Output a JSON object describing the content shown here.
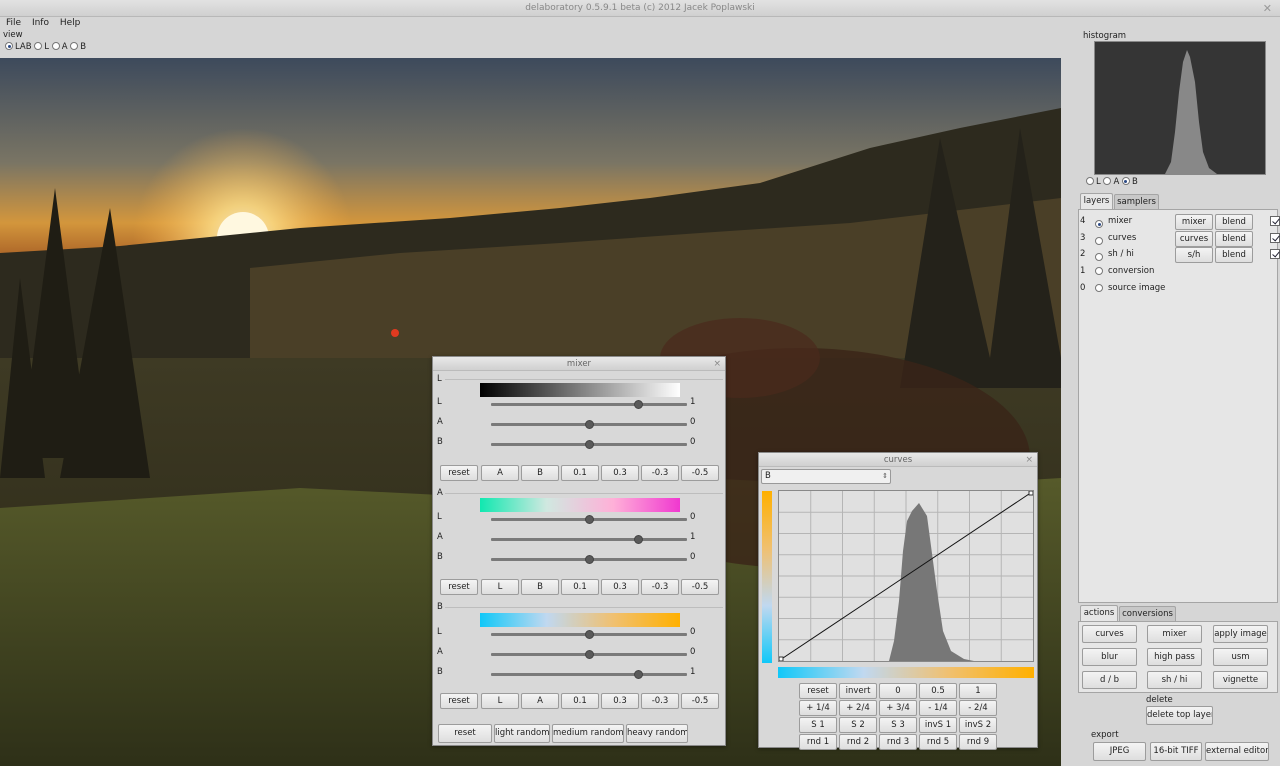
{
  "window": {
    "title": "delaboratory 0.5.9.1 beta (c) 2012 Jacek Poplawski"
  },
  "menu": [
    "File",
    "Info",
    "Help"
  ],
  "view": {
    "label": "view",
    "options": [
      "LAB",
      "L",
      "A",
      "B"
    ],
    "selected": "LAB"
  },
  "histogram": {
    "label": "histogram",
    "options": [
      "L",
      "A",
      "B"
    ],
    "selected": "B"
  },
  "layers_tabs": [
    "layers",
    "samplers"
  ],
  "layers": [
    {
      "index": "4",
      "name": "mixer",
      "selected": true,
      "buttons": [
        "mixer",
        "blend"
      ],
      "enabled": true
    },
    {
      "index": "3",
      "name": "curves",
      "selected": false,
      "buttons": [
        "curves",
        "blend"
      ],
      "enabled": true
    },
    {
      "index": "2",
      "name": "sh / hi",
      "selected": false,
      "buttons": [
        "s/h",
        "blend"
      ],
      "enabled": true
    },
    {
      "index": "1",
      "name": "conversion",
      "selected": false,
      "buttons": [],
      "enabled": false
    },
    {
      "index": "0",
      "name": "source image",
      "selected": false,
      "buttons": [],
      "enabled": false
    }
  ],
  "actions_tabs": [
    "actions",
    "conversions"
  ],
  "actions": [
    "curves",
    "mixer",
    "apply image",
    "blur",
    "high pass",
    "usm",
    "d / b",
    "sh / hi",
    "vignette"
  ],
  "delete": {
    "label": "delete",
    "button": "delete top layer"
  },
  "export": {
    "label": "export",
    "buttons": [
      "JPEG",
      "16-bit TIFF",
      "external editor"
    ]
  },
  "mixer": {
    "title": "mixer",
    "close": "×",
    "sections": [
      {
        "name": "L",
        "rows": [
          {
            "ch": "L",
            "value": "1",
            "pos": 0.75
          },
          {
            "ch": "A",
            "value": "0",
            "pos": 0.5
          },
          {
            "ch": "B",
            "value": "0",
            "pos": 0.5
          }
        ],
        "buttons": [
          "reset",
          "A",
          "B",
          "0.1",
          "0.3",
          "-0.3",
          "-0.5"
        ]
      },
      {
        "name": "A",
        "rows": [
          {
            "ch": "L",
            "value": "0",
            "pos": 0.5
          },
          {
            "ch": "A",
            "value": "1",
            "pos": 0.75
          },
          {
            "ch": "B",
            "value": "0",
            "pos": 0.5
          }
        ],
        "buttons": [
          "reset",
          "L",
          "B",
          "0.1",
          "0.3",
          "-0.3",
          "-0.5"
        ]
      },
      {
        "name": "B",
        "rows": [
          {
            "ch": "L",
            "value": "0",
            "pos": 0.5
          },
          {
            "ch": "A",
            "value": "0",
            "pos": 0.5
          },
          {
            "ch": "B",
            "value": "1",
            "pos": 0.75
          }
        ],
        "buttons": [
          "reset",
          "L",
          "A",
          "0.1",
          "0.3",
          "-0.3",
          "-0.5"
        ]
      }
    ],
    "bottom_buttons": [
      "reset",
      "light random",
      "medium random",
      "heavy random"
    ]
  },
  "curves": {
    "title": "curves",
    "close": "×",
    "channel": "B",
    "buttons": [
      [
        "reset",
        "invert",
        "0",
        "0.5",
        "1"
      ],
      [
        "+ 1/4",
        "+ 2/4",
        "+ 3/4",
        "- 1/4",
        "- 2/4"
      ],
      [
        "S 1",
        "S 2",
        "S 3",
        "invS 1",
        "invS 2"
      ],
      [
        "rnd 1",
        "rnd 2",
        "rnd 3",
        "rnd 5",
        "rnd 9"
      ]
    ]
  },
  "colors": {
    "accent": "#2c4a84",
    "panel": "#d6d6d6"
  }
}
